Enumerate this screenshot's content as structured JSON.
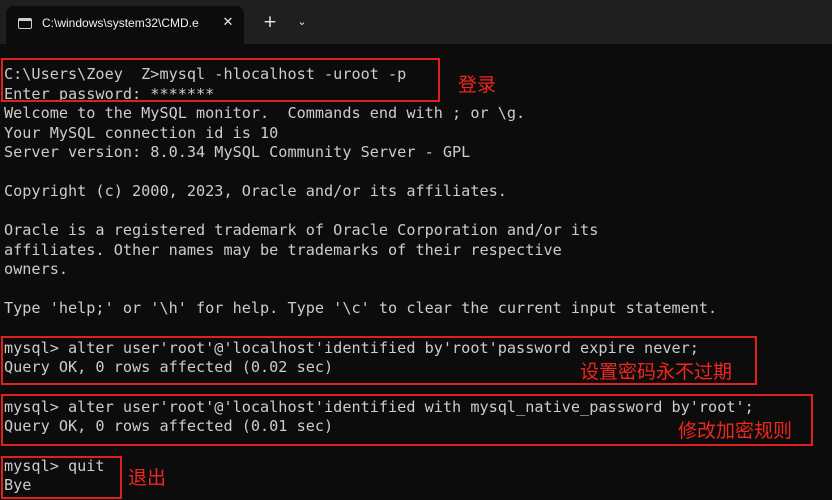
{
  "window": {
    "tab_title": "C:\\windows\\system32\\CMD.e",
    "close_glyph": "✕",
    "new_tab_glyph": "+",
    "dropdown_glyph": "⌄"
  },
  "terminal": {
    "lines": [
      "C:\\Users\\Zoey  Z>mysql -hlocalhost -uroot -p",
      "Enter password: *******",
      "Welcome to the MySQL monitor.  Commands end with ; or \\g.",
      "Your MySQL connection id is 10",
      "Server version: 8.0.34 MySQL Community Server - GPL",
      "",
      "Copyright (c) 2000, 2023, Oracle and/or its affiliates.",
      "",
      "Oracle is a registered trademark of Oracle Corporation and/or its",
      "affiliates. Other names may be trademarks of their respective",
      "owners.",
      "",
      "Type 'help;' or '\\h' for help. Type '\\c' to clear the current input statement.",
      "",
      "mysql> alter user'root'@'localhost'identified by'root'password expire never;",
      "Query OK, 0 rows affected (0.02 sec)",
      "",
      "mysql> alter user'root'@'localhost'identified with mysql_native_password by'root';",
      "Query OK, 0 rows affected (0.01 sec)",
      "",
      "mysql> quit",
      "Bye"
    ]
  },
  "annotations": {
    "login": "登录",
    "set_password_never_expire": "设置密码永不过期",
    "change_encryption_rule": "修改加密规则",
    "exit": "退出"
  },
  "colors": {
    "background": "#0c0c0c",
    "text": "#cccccc",
    "annotation": "#f0261f"
  }
}
